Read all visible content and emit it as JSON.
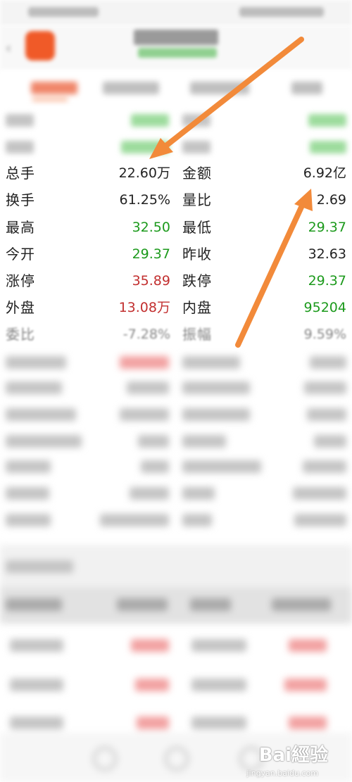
{
  "stats": [
    {
      "label_a": "总手",
      "value_a": "22.60万",
      "color_a": "black",
      "label_b": "金额",
      "value_b": "6.92亿",
      "color_b": "black"
    },
    {
      "label_a": "换手",
      "value_a": "61.25%",
      "color_a": "black",
      "label_b": "量比",
      "value_b": "2.69",
      "color_b": "black"
    },
    {
      "label_a": "最高",
      "value_a": "32.50",
      "color_a": "green",
      "label_b": "最低",
      "value_b": "29.37",
      "color_b": "green"
    },
    {
      "label_a": "今开",
      "value_a": "29.37",
      "color_a": "green",
      "label_b": "昨收",
      "value_b": "32.63",
      "color_b": "black"
    },
    {
      "label_a": "涨停",
      "value_a": "35.89",
      "color_a": "red",
      "label_b": "跌停",
      "value_b": "29.37",
      "color_b": "green"
    },
    {
      "label_a": "外盘",
      "value_a": "13.08万",
      "color_a": "red",
      "label_b": "内盘",
      "value_b": "95204",
      "color_b": "green"
    },
    {
      "label_a": "委比",
      "value_a": "-7.28%",
      "color_a": "black",
      "label_b": "振幅",
      "value_b": "9.59%",
      "color_b": "black"
    }
  ],
  "colors": {
    "green": "#1c9a1c",
    "red": "#c22f2f",
    "black": "#222222",
    "accent": "#f05a28",
    "arrow": "#f28a3a"
  },
  "icons": {
    "back": "‹"
  },
  "watermark": {
    "brand": "Bai經验",
    "site": "jingyan.baidu.com"
  }
}
